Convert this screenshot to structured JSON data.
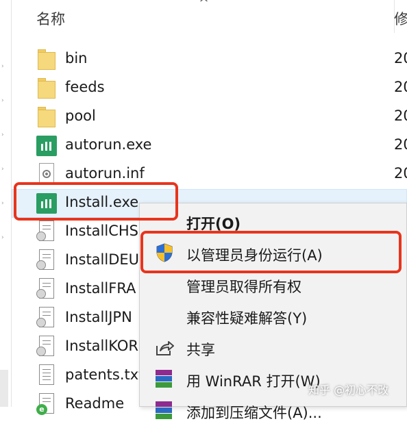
{
  "header": {
    "col_name": "名称",
    "col_modified": "修",
    "sort_arrow": "^"
  },
  "files": [
    {
      "name": "bin",
      "date": "20",
      "icon": "folder-icon"
    },
    {
      "name": "feeds",
      "date": "20",
      "icon": "folder-icon"
    },
    {
      "name": "pool",
      "date": "20",
      "icon": "folder-icon"
    },
    {
      "name": "autorun.exe",
      "date": "20",
      "icon": "app-icon"
    },
    {
      "name": "autorun.inf",
      "date": "20",
      "icon": "settings-file-icon"
    },
    {
      "name": "Install.exe",
      "date": "",
      "icon": "app-icon",
      "selected": true
    },
    {
      "name": "InstallCHS",
      "date": "",
      "icon": "config-file-icon"
    },
    {
      "name": "InstallDEU",
      "date": "",
      "icon": "config-file-icon"
    },
    {
      "name": "InstallFRA",
      "date": "",
      "icon": "config-file-icon"
    },
    {
      "name": "InstallJPN",
      "date": "",
      "icon": "config-file-icon"
    },
    {
      "name": "InstallKOR",
      "date": "",
      "icon": "config-file-icon"
    },
    {
      "name": "patents.txt",
      "date": "",
      "icon": "text-file-icon"
    },
    {
      "name": "Readme",
      "date": "",
      "icon": "readme-file-icon"
    }
  ],
  "context_menu": {
    "items": [
      {
        "label": "打开(O)",
        "icon": "",
        "bold": true
      },
      {
        "label": "以管理员身份运行(A)",
        "icon": "uac-shield-icon"
      },
      {
        "label": "管理员取得所有权",
        "icon": ""
      },
      {
        "label": "兼容性疑难解答(Y)",
        "icon": ""
      },
      {
        "label": "共享",
        "icon": "share-icon"
      },
      {
        "label": "用 WinRAR 打开(W)",
        "icon": "winrar-icon"
      },
      {
        "label": "添加到压缩文件(A)...",
        "icon": "winrar-icon"
      }
    ]
  },
  "colors": {
    "highlight": "#e8341c",
    "selection": "#e5f1fb",
    "app_icon": "#2a9d63",
    "folder": "#f5d97c"
  },
  "watermark": "知乎 @初心不改"
}
